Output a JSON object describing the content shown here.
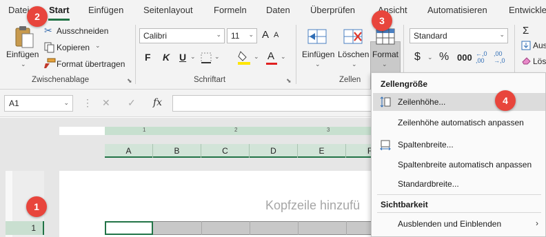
{
  "tabs": [
    "Datei",
    "Start",
    "Einfügen",
    "Seitenlayout",
    "Formeln",
    "Daten",
    "Überprüfen",
    "Ansicht",
    "Automatisieren",
    "Entwickle"
  ],
  "clipboard": {
    "paste": "Einfügen",
    "cut": "Ausschneiden",
    "copy": "Kopieren",
    "format_painter": "Format übertragen",
    "group": "Zwischenablage"
  },
  "font": {
    "name": "Calibri",
    "size": "11",
    "bold": "F",
    "italic": "K",
    "underline": "U",
    "font_color_glyph": "A",
    "grow_glyph": "A",
    "shrink_glyph": "A",
    "group": "Schriftart"
  },
  "cells": {
    "insert": "Einfügen",
    "delete": "Löschen",
    "format": "Format",
    "group": "Zellen"
  },
  "number": {
    "format": "Standard",
    "currency": "$",
    "percent": "%",
    "comma": "000",
    "dec_inc": "←,0\n,00",
    "dec_dec": ",00\n→,0"
  },
  "editing": {
    "autosum": "Σ",
    "fill_cut": "Aus",
    "clear_cut": "Lös"
  },
  "formula_bar": {
    "name_box": "A1",
    "cancel": "✕",
    "enter": "✓",
    "fx": "fx"
  },
  "sheet": {
    "ruler_marks": [
      "1",
      "2",
      "3"
    ],
    "columns": [
      "A",
      "B",
      "C",
      "D",
      "E",
      "F"
    ],
    "row": "1",
    "header_placeholder": "Kopfzeile hinzufü"
  },
  "menu": {
    "section_size": "Zellengröße",
    "row_height": "Zeilenhöhe...",
    "autofit_row": "Zeilenhöhe automatisch anpassen",
    "col_width": "Spaltenbreite...",
    "autofit_col": "Spaltenbreite automatisch anpassen",
    "default_width": "Standardbreite...",
    "section_visibility": "Sichtbarkeit",
    "hide_unhide": "Ausblenden und Einblenden",
    "submenu_arrow": "›"
  },
  "badges": [
    "1",
    "2",
    "3",
    "4"
  ],
  "colors": {
    "accent": "#217346",
    "badge": "#e8453c",
    "ribbon_bg": "#f3f3f3",
    "highlight_yellow": "#ffe600",
    "font_red": "#e02020"
  }
}
